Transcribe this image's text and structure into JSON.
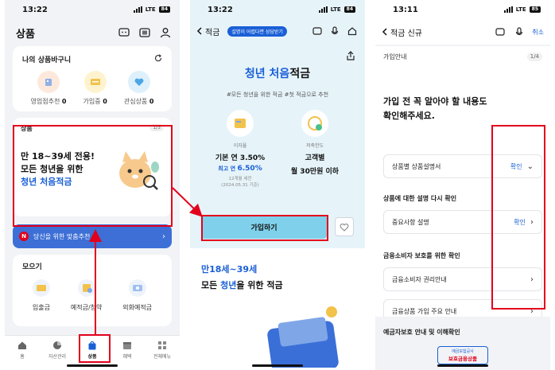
{
  "panel1": {
    "status": {
      "time": "13:22",
      "network": "LTE",
      "battery": "84"
    },
    "title": "상품",
    "basket": {
      "title": "나의 상품바구니",
      "items": [
        {
          "label": "영업점추천",
          "count": "0"
        },
        {
          "label": "가입중",
          "count": "0"
        },
        {
          "label": "관심상품",
          "count": "0"
        }
      ]
    },
    "product": {
      "label": "상품",
      "pager": "1/3",
      "line1": "만 18~39세 전용!",
      "line2": "모든 청년을 위한",
      "line3": "청년 처음적금"
    },
    "banner": {
      "badge": "N",
      "text": "당신을 위한 맞춤추천"
    },
    "collect": {
      "title": "모으기",
      "items": [
        "입출금",
        "예적금/청약",
        "외화예적금"
      ]
    },
    "tabs": [
      "홈",
      "자산관리",
      "상품",
      "혜택",
      "전체메뉴"
    ]
  },
  "panel2": {
    "status": {
      "time": "13:22",
      "network": "LTE",
      "battery": "84"
    },
    "back_label": "적금",
    "tooltip": "설명이 어렵다면 상담받기",
    "title_blue": "청년 처음",
    "title_rest": "적금",
    "tags": "#모든 청년을 위한 적금   #첫 적금으로 추천",
    "rate": {
      "caption": "이자율",
      "base": "기본 연 3.50%",
      "max_prefix": "최고 연 ",
      "max": "6.50%",
      "note1": "12개월 세전",
      "note2": "(2024.05.31 기준)"
    },
    "limit": {
      "caption": "저축한도",
      "line1": "고객별",
      "line2": "월 30만원 이하"
    },
    "join_label": "가입하기",
    "sub1": "만18세~39세",
    "sub2_pre": "모든 ",
    "sub2_blue": "청년",
    "sub2_post": "을 위한 적금"
  },
  "panel3": {
    "status": {
      "time": "13:11",
      "network": "LTE",
      "battery": "85"
    },
    "back_label": "적금 신규",
    "cancel": "취소",
    "step_label": "가입안내",
    "step_count": "1/4",
    "heading1": "가입 전 꼭 알아야 할 내용도",
    "heading2": "확인해주세요.",
    "row1": {
      "label": "상품별 상품설명서",
      "confirm": "확인"
    },
    "section2": "상품에 대한 설명 다시 확인",
    "row2": {
      "label": "중요사항 설명",
      "confirm": "확인"
    },
    "section3": "금융소비자 보호를 위한 확인",
    "row3": {
      "label": "금융소비자 권리안내"
    },
    "row4": {
      "label": "금융상품 가입 주요 안내"
    },
    "footer_title": "예금자보호 안내 및 이해확인",
    "protect_small": "예금보험공사",
    "protect_big": "보호금융상품"
  },
  "colors": {
    "accent": "#1a5fd6",
    "highlight": "#e3001b",
    "join": "#7fd0ea"
  }
}
